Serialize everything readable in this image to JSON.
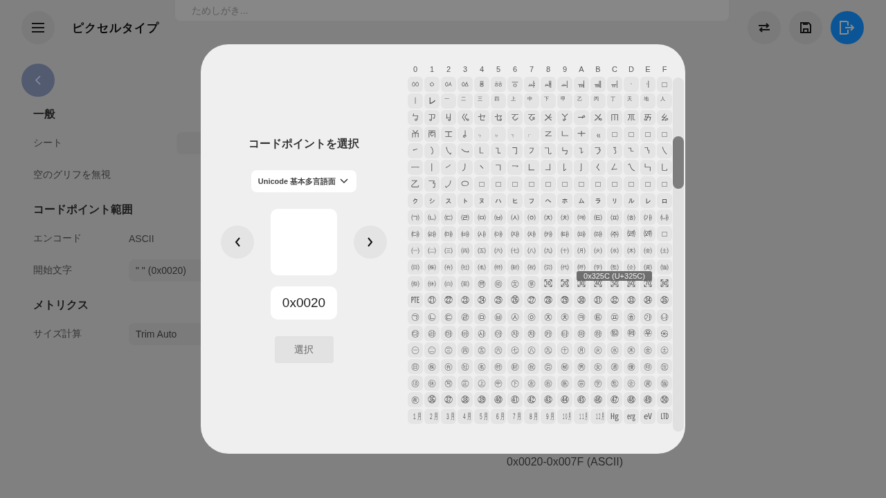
{
  "header": {
    "logo": "ピクセルタイプ",
    "search": {
      "placeholder": "ためしがき..."
    }
  },
  "settings": [
    {
      "title": "一般",
      "rows": [
        {
          "label": "シート",
          "kind": "button"
        },
        {
          "label": "空のグリフを無視",
          "kind": "plain"
        }
      ]
    },
    {
      "title": "コードポイント範囲",
      "rows": [
        {
          "label": "エンコード",
          "kind": "text",
          "value": "ASCII"
        },
        {
          "label": "開始文字",
          "kind": "field",
          "value": "\" \" (0x0020)"
        }
      ]
    },
    {
      "title": "メトリクス",
      "rows": [
        {
          "label": "サイズ計算",
          "kind": "field",
          "value": "Trim Auto"
        }
      ]
    }
  ],
  "range_summary": "0x0020-0x007F (ASCII)",
  "dialog": {
    "title": "コードポイントを選択",
    "plane": "Unicode 基本多言語面",
    "code": "0x0020",
    "select_button": "選択",
    "columns": [
      "0",
      "1",
      "2",
      "3",
      "4",
      "5",
      "6",
      "7",
      "8",
      "9",
      "A",
      "B",
      "C",
      "D",
      "E",
      "F"
    ],
    "rows": [
      [
        "ㆀ",
        "ㆁ",
        "ㆂ",
        "ㆃ",
        "ㆄ",
        "ㆅ",
        "ㆆ",
        "ㆇ",
        "ㆈ",
        "ㆉ",
        "ㆊ",
        "ㆋ",
        "ㆌ",
        "ㆍ",
        "ㆎ",
        "□"
      ],
      [
        "㆐",
        "㆑",
        "㆒",
        "㆓",
        "㆔",
        "㆕",
        "㆖",
        "㆗",
        "㆘",
        "㆙",
        "㆚",
        "㆛",
        "㆜",
        "㆝",
        "㆞",
        "㆟"
      ],
      [
        "ㆠ",
        "ㆡ",
        "ㆢ",
        "ㆣ",
        "ㆤ",
        "ㆥ",
        "ㆦ",
        "ㆧ",
        "ㆨ",
        "ㆩ",
        "ㆪ",
        "ㆫ",
        "ㆬ",
        "ㆭ",
        "ㆮ",
        "ㆯ"
      ],
      [
        "ㆰ",
        "ㆱ",
        "ㆲ",
        "ㆳ",
        "ㆴ",
        "ㆵ",
        "ㆶ",
        "ㆷ",
        "ㆸ",
        "ㆹ",
        "ㆺ",
        "ㆻ",
        "□",
        "□",
        "□",
        "□"
      ],
      [
        "㇀",
        "㇁",
        "㇂",
        "㇃",
        "㇄",
        "㇅",
        "㇆",
        "㇇",
        "㇈",
        "㇉",
        "㇊",
        "㇋",
        "㇌",
        "㇍",
        "㇎",
        "㇏"
      ],
      [
        "㇐",
        "㇑",
        "㇒",
        "㇓",
        "㇔",
        "㇕",
        "㇖",
        "㇗",
        "㇘",
        "㇙",
        "㇚",
        "㇛",
        "㇜",
        "㇝",
        "㇞",
        "㇟"
      ],
      [
        "㇠",
        "㇡",
        "㇢",
        "㇣",
        "□",
        "□",
        "□",
        "□",
        "□",
        "□",
        "□",
        "□",
        "□",
        "□",
        "□",
        "□"
      ],
      [
        "ㇰ",
        "ㇱ",
        "ㇲ",
        "ㇳ",
        "ㇴ",
        "ㇵ",
        "ㇶ",
        "ㇷ",
        "ㇸ",
        "ㇹ",
        "ㇺ",
        "ㇻ",
        "ㇼ",
        "ㇽ",
        "ㇾ",
        "ㇿ"
      ],
      [
        "㈀",
        "㈁",
        "㈂",
        "㈃",
        "㈄",
        "㈅",
        "㈆",
        "㈇",
        "㈈",
        "㈉",
        "㈊",
        "㈋",
        "㈌",
        "㈍",
        "㈎",
        "㈏"
      ],
      [
        "㈐",
        "㈑",
        "㈒",
        "㈓",
        "㈔",
        "㈕",
        "㈖",
        "㈗",
        "㈘",
        "㈙",
        "㈚",
        "㈛",
        "㈜",
        "㈝",
        "㈞",
        "□"
      ],
      [
        "㈠",
        "㈡",
        "㈢",
        "㈣",
        "㈤",
        "㈥",
        "㈦",
        "㈧",
        "㈨",
        "㈩",
        "㈪",
        "㈫",
        "㈬",
        "㈭",
        "㈮",
        "㈯"
      ],
      [
        "㈰",
        "㈱",
        "㈲",
        "㈳",
        "㈴",
        "㈵",
        "㈶",
        "㈷",
        "㈸",
        "㈹",
        "㈺",
        "㈻",
        "㈼",
        "㈽",
        "㈾",
        "㈿"
      ],
      [
        "㉀",
        "㉁",
        "㉂",
        "㉃",
        "㉄",
        "㉅",
        "㉆",
        "㉇",
        "㉈",
        "㉉",
        "㉊",
        "㉋",
        "㉌",
        "㉍",
        "㉎",
        "㉏"
      ],
      [
        "㉐",
        "㉑",
        "㉒",
        "㉓",
        "㉔",
        "㉕",
        "㉖",
        "㉗",
        "㉘",
        "㉙",
        "㉚",
        "㉛",
        "㉜",
        "㉝",
        "㉞",
        "㉟"
      ],
      [
        "㉠",
        "㉡",
        "㉢",
        "㉣",
        "㉤",
        "㉥",
        "㉦",
        "㉧",
        "㉨",
        "㉩",
        "㉪",
        "㉫",
        "㉬",
        "㉭",
        "㉮",
        "㉯"
      ],
      [
        "㉰",
        "㉱",
        "㉲",
        "㉳",
        "㉴",
        "㉵",
        "㉶",
        "㉷",
        "㉸",
        "㉹",
        "㉺",
        "㉻",
        "㉼",
        "㉽",
        "㉾",
        "㉿"
      ],
      [
        "㊀",
        "㊁",
        "㊂",
        "㊃",
        "㊄",
        "㊅",
        "㊆",
        "㊇",
        "㊈",
        "㊉",
        "㊊",
        "㊋",
        "㊌",
        "㊍",
        "㊎",
        "㊏"
      ],
      [
        "㊐",
        "㊑",
        "㊒",
        "㊓",
        "㊔",
        "㊕",
        "㊖",
        "㊗",
        "㊘",
        "㊙",
        "㊚",
        "㊛",
        "㊜",
        "㊝",
        "㊞",
        "㊟"
      ],
      [
        "㊠",
        "㊡",
        "㊢",
        "㊣",
        "㊤",
        "㊥",
        "㊦",
        "㊧",
        "㊨",
        "㊩",
        "㊪",
        "㊫",
        "㊬",
        "㊭",
        "㊮",
        "㊯"
      ],
      [
        "㊰",
        "㊱",
        "㊲",
        "㊳",
        "㊴",
        "㊵",
        "㊶",
        "㊷",
        "㊸",
        "㊹",
        "㊺",
        "㊻",
        "㊼",
        "㊽",
        "㊾",
        "㊿"
      ],
      [
        "㋀",
        "㋁",
        "㋂",
        "㋃",
        "㋄",
        "㋅",
        "㋆",
        "㋇",
        "㋈",
        "㋉",
        "㋊",
        "㋋",
        "㋌",
        "㋍",
        "㋎",
        "㋏"
      ]
    ],
    "tooltip": "0x325C (U+325C)"
  }
}
